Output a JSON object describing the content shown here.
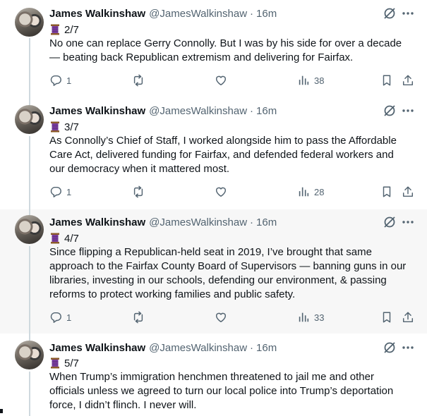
{
  "author": {
    "name": "James Walkinshaw",
    "handle": "@JamesWalkinshaw",
    "time": "16m",
    "separator": "·"
  },
  "tweets": [
    {
      "index": "2/7",
      "lines": [
        "No one can replace Gerry Connolly. But I was by his side for over a decade",
        "— beating back Republican extremism and delivering for Fairfax."
      ],
      "replies": "1",
      "views": "38"
    },
    {
      "index": "3/7",
      "lines": [
        "As Connolly’s Chief of Staff, I worked alongside him to pass the Affordable",
        "Care Act, delivered funding for Fairfax, and defended federal workers and",
        "our democracy when it mattered most."
      ],
      "replies": "1",
      "views": "28"
    },
    {
      "index": "4/7",
      "lines": [
        "Since flipping a Republican-held seat in 2019, I’ve brought that same",
        "approach to the Fairfax County Board of Supervisors — banning guns in our",
        "libraries, investing in our schools, defending our environment, & passing",
        "reforms to protect working families and public safety."
      ],
      "replies": "1",
      "views": "33"
    },
    {
      "index": "5/7",
      "lines": [
        "When Trump’s immigration henchmen threatened to jail me and other",
        "officials unless we agreed to turn our local police into Trump’s deportation",
        "force, I didn’t flinch. I never will."
      ]
    }
  ],
  "icons": {
    "thread_marker": "spool-of-thread-icon",
    "grok": "grok-icon",
    "more": "more-icon",
    "reply": "reply-icon",
    "repost": "repost-icon",
    "like": "like-icon",
    "views": "views-icon",
    "bookmark": "bookmark-icon",
    "share": "share-icon"
  },
  "colors": {
    "text": "#0f1419",
    "secondary": "#536471",
    "thread_line": "#cfd9de",
    "highlight_bg": "#f7f7f7",
    "spool": "#7b3fa0"
  }
}
